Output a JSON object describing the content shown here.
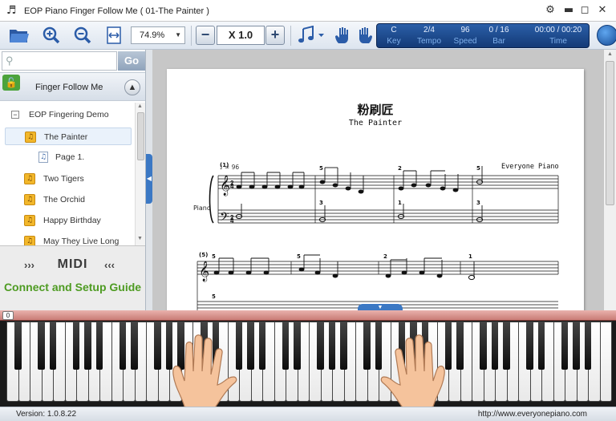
{
  "titlebar": {
    "title": "EOP Piano Finger Follow Me  ( 01-The Painter )",
    "app_icon": "music-note-icon"
  },
  "toolbar": {
    "zoom_value": "74.9%",
    "speed_value": "X 1.0",
    "minus_label": "−",
    "plus_label": "+"
  },
  "status_panel": {
    "key": {
      "value": "C",
      "label": "Key"
    },
    "tempo": {
      "value": "2/4",
      "label": "Tempo"
    },
    "speed": {
      "value": "96",
      "label": "Speed"
    },
    "bar": {
      "value": "0 / 16",
      "label": "Bar"
    },
    "time": {
      "value": "00:00 / 00:20",
      "label": "Time"
    }
  },
  "sidebar": {
    "search_placeholder": "",
    "go_label": "Go",
    "section_title": "Finger Follow Me",
    "tree": [
      {
        "label": "EOP Fingering Demo",
        "type": "folder"
      },
      {
        "label": "The Painter",
        "type": "song",
        "selected": true
      },
      {
        "label": "Page 1.",
        "type": "page"
      },
      {
        "label": "Two Tigers",
        "type": "song"
      },
      {
        "label": "The Orchid",
        "type": "song"
      },
      {
        "label": "Happy Birthday",
        "type": "song"
      },
      {
        "label": "May They Live Long",
        "type": "song"
      }
    ],
    "midi_label": "MIDI",
    "midi_left_arrows": "›››",
    "midi_right_arrows": "‹‹‹",
    "guide_link": "Connect and Setup Guide"
  },
  "score": {
    "title": "粉刷匠",
    "subtitle": "The Painter",
    "composer": "Everyone Piano",
    "instrument": "Piano",
    "tempo_mark": "♩ = 96"
  },
  "keyboard": {
    "position_badge": "0"
  },
  "statusbar": {
    "version": "Version: 1.0.8.22",
    "url": "http://www.everyonepiano.com"
  }
}
